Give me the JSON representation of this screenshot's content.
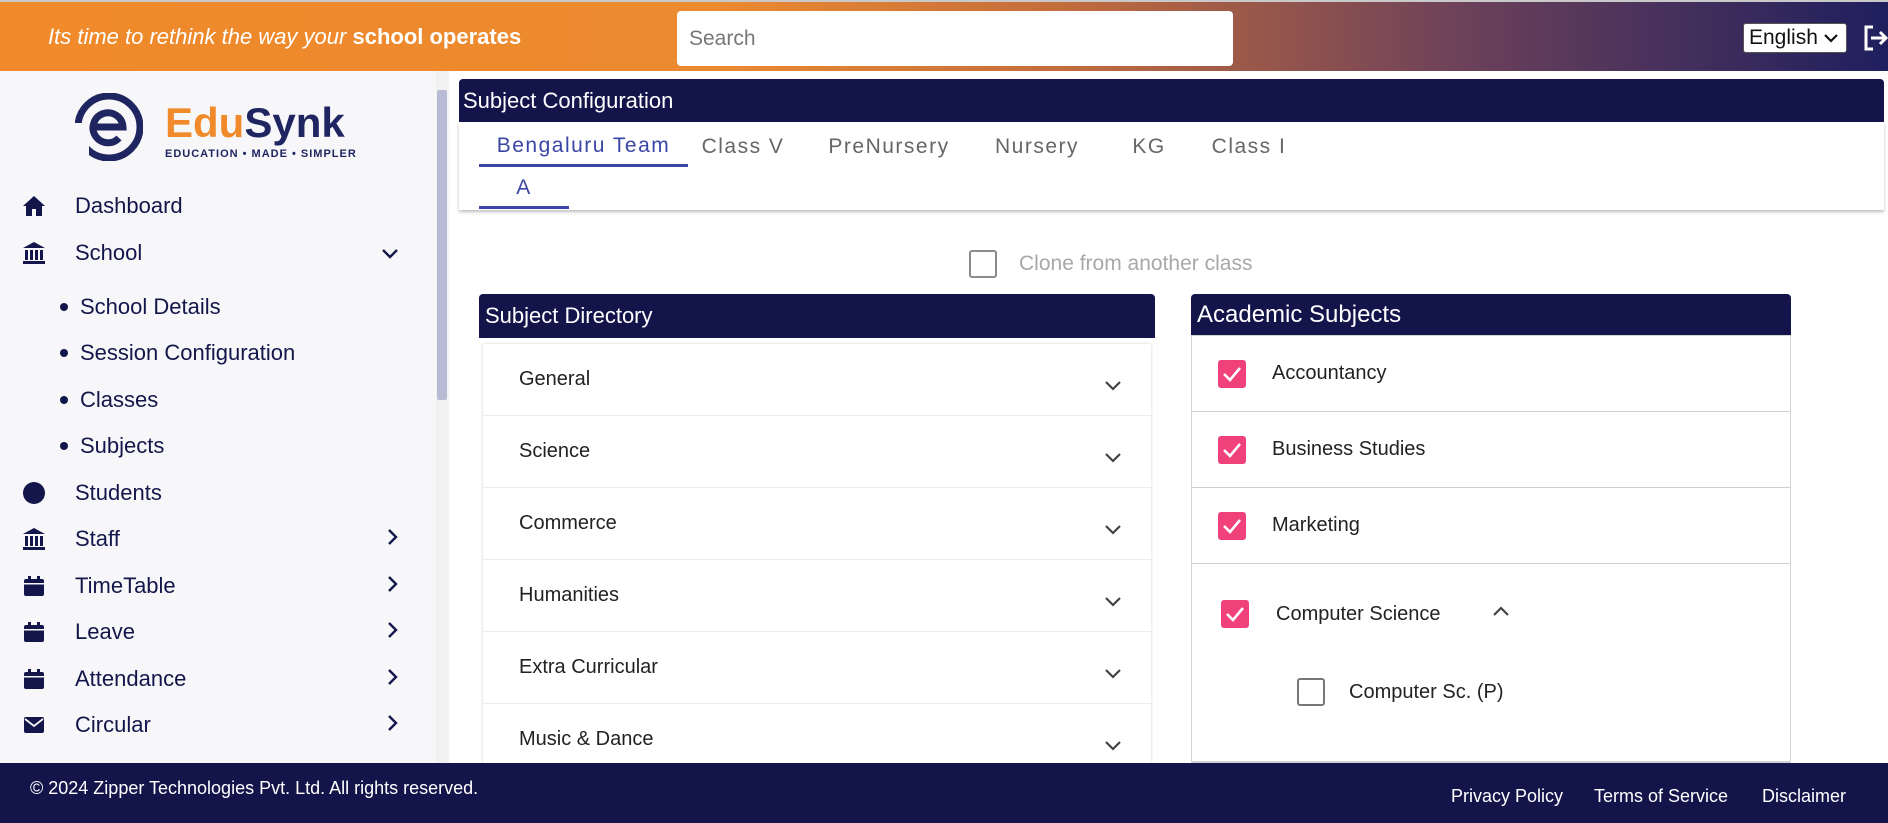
{
  "header": {
    "tagline_prefix": "Its time to rethink the way your ",
    "tagline_bold": "school operates",
    "search_placeholder": "Search",
    "language": "English"
  },
  "sidebar": {
    "logo_name_a": "Edu",
    "logo_name_b": "Synk",
    "logo_sub": "EDUCATION • MADE • SIMPLER",
    "items": [
      {
        "label": "Dashboard",
        "icon": "home-icon"
      },
      {
        "label": "School",
        "icon": "institution-icon",
        "expanded": true
      },
      {
        "label": "Students",
        "icon": "circle-icon"
      },
      {
        "label": "Staff",
        "icon": "institution-icon"
      },
      {
        "label": "TimeTable",
        "icon": "calendar-icon"
      },
      {
        "label": "Leave",
        "icon": "calendar-icon"
      },
      {
        "label": "Attendance",
        "icon": "calendar-icon"
      },
      {
        "label": "Circular",
        "icon": "envelope-icon"
      }
    ],
    "school_sub_items": [
      "School Details",
      "Session Configuration",
      "Classes",
      "Subjects"
    ]
  },
  "main": {
    "title": "Subject Configuration",
    "tabs": [
      "Bengaluru Team",
      "Class V",
      "PreNursery",
      "Nursery",
      "KG",
      "Class I",
      "A"
    ],
    "active_tab": "Bengaluru Team",
    "clone_label": "Clone from another class",
    "directory": {
      "title": "Subject Directory",
      "groups": [
        "General",
        "Science",
        "Commerce",
        "Humanities",
        "Extra Curricular",
        "Music & Dance"
      ]
    },
    "academic": {
      "title": "Academic Subjects",
      "subjects": [
        {
          "label": "Accountancy",
          "checked": true
        },
        {
          "label": "Business Studies",
          "checked": true
        },
        {
          "label": "Marketing",
          "checked": true
        },
        {
          "label": "Computer Science",
          "checked": true
        },
        {
          "label": "Computer Sc. (P)",
          "checked": false
        }
      ]
    }
  },
  "footer": {
    "copyright": "© 2024 Zipper Technologies Pvt. Ltd. All rights reserved.",
    "links": [
      "Privacy Policy",
      "Terms of Service",
      "Disclaimer"
    ]
  },
  "colors": {
    "navy": "#13144a",
    "orange": "#f08a2a",
    "check_pink": "#f0417a",
    "tab_active": "#3a46a6"
  }
}
